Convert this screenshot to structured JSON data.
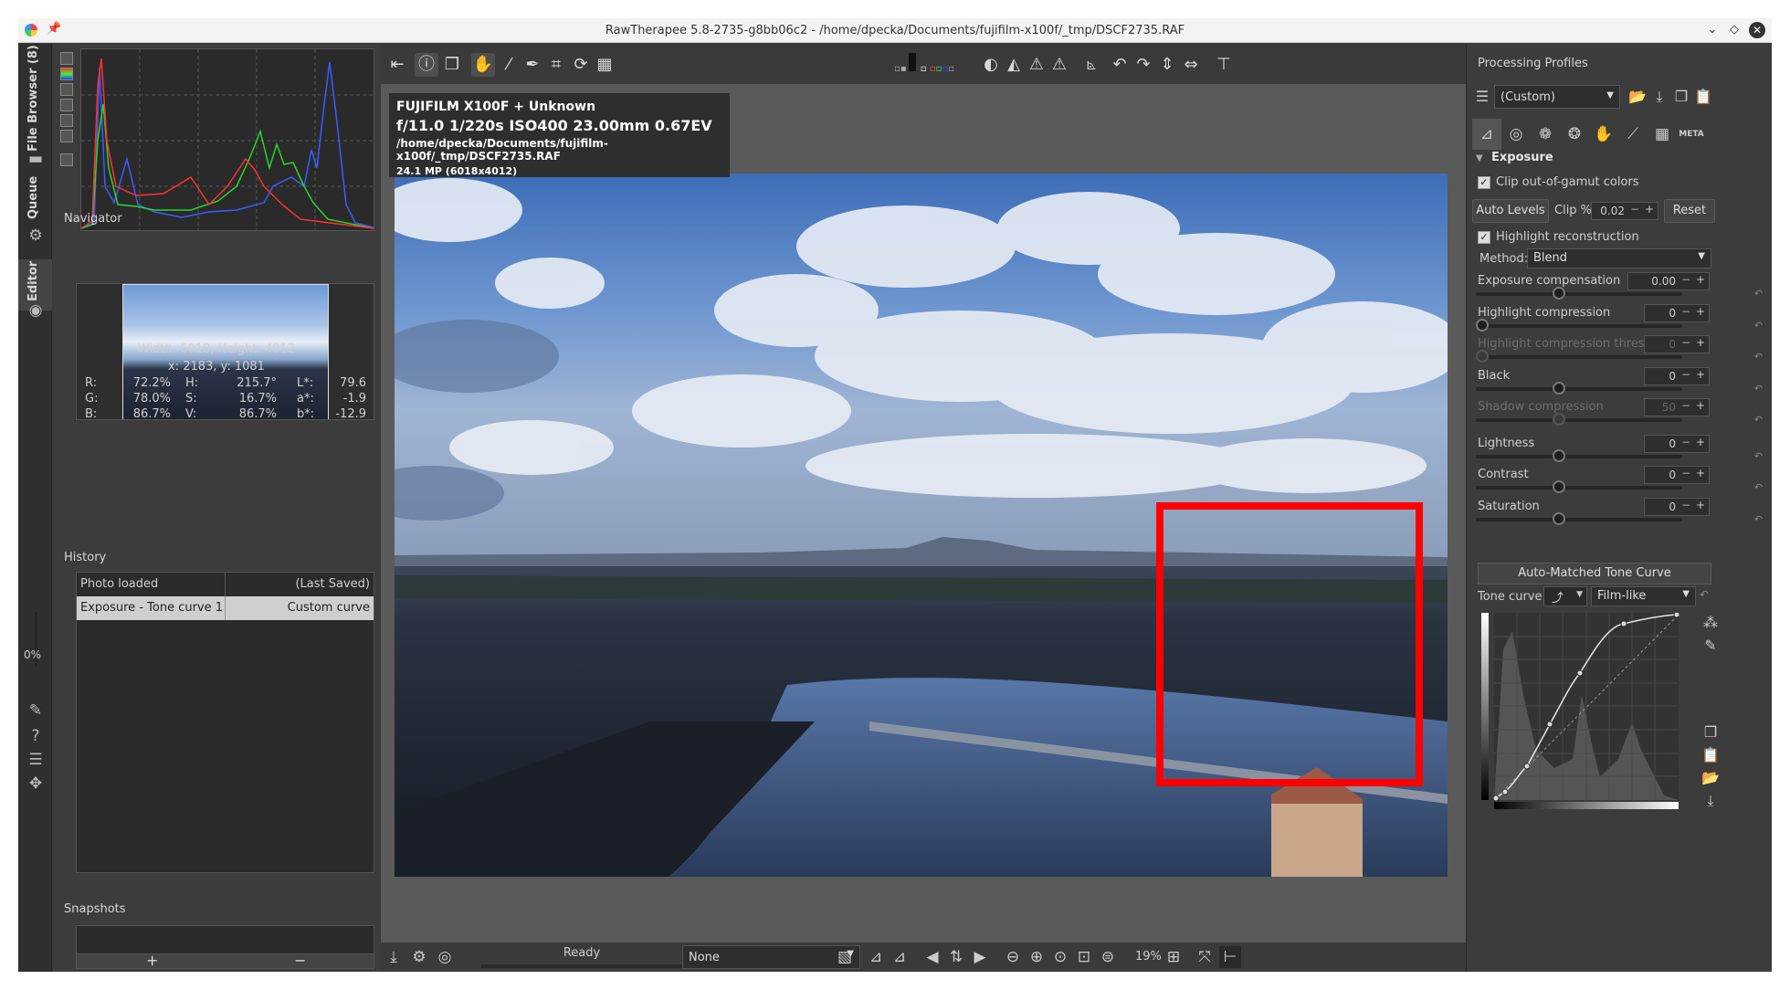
{
  "window": {
    "title": "RawTherapee 5.8-2735-g8bb06c2 - /home/dpecka/Documents/fujifilm-x100f/_tmp/DSCF2735.RAF"
  },
  "vtabs": {
    "file_browser": "File Browser (8)",
    "queue": "Queue",
    "editor": "Editor",
    "progress": "0%"
  },
  "left": {
    "navigator_title": "Navigator",
    "dimensions": "Width: 6018, Height: 4012",
    "cursor": "x: 2183, y: 1081",
    "pixel_rows": [
      {
        "a": "R:",
        "av": "72.2%",
        "b": "H:",
        "bv": "215.7°",
        "c": "L*:",
        "cv": "79.6"
      },
      {
        "a": "G:",
        "av": "78.0%",
        "b": "S:",
        "bv": "16.7%",
        "c": "a*:",
        "cv": "-1.9"
      },
      {
        "a": "B:",
        "av": "86.7%",
        "b": "V:",
        "bv": "86.7%",
        "c": "b*:",
        "cv": "-12.9"
      }
    ],
    "history_title": "History",
    "history": [
      {
        "action": "Photo loaded",
        "value": "(Last Saved)"
      },
      {
        "action": "Exposure - Tone curve 1",
        "value": "Custom curve"
      }
    ],
    "snapshots_title": "Snapshots",
    "snap_add": "+",
    "snap_remove": "−"
  },
  "overlay": {
    "camera": "FUJIFILM X100F + Unknown",
    "exposure": "f/11.0  1/220s  ISO400  23.00mm  0.67EV",
    "path": "/home/dpecka/Documents/fujifilm-x100f/_tmp/DSCF2735.RAF",
    "size": "24.1 MP (6018x4012)"
  },
  "bottom": {
    "status": "Ready",
    "preset": "None",
    "zoom": "19%"
  },
  "right": {
    "title": "Processing Profiles",
    "profile": "(Custom)",
    "meta_tab": "META",
    "section": "Exposure",
    "clip_gamut": "Clip out-of-gamut colors",
    "auto_levels": "Auto Levels",
    "clip_label": "Clip %",
    "clip_value": "0.02",
    "reset": "Reset",
    "highlight_recon": "Highlight reconstruction",
    "method_label": "Method:",
    "method_value": "Blend",
    "sliders": [
      {
        "label": "Exposure compensation",
        "value": "0.00",
        "pos": 0.39,
        "enabled": true
      },
      {
        "label": "Highlight compression",
        "value": "0",
        "pos": 0.0,
        "enabled": true
      },
      {
        "label": "Highlight compression threshold",
        "value": "0",
        "pos": 0.0,
        "enabled": false
      },
      {
        "label": "Black",
        "value": "0",
        "pos": 0.39,
        "enabled": true
      },
      {
        "label": "Shadow compression",
        "value": "50",
        "pos": 0.39,
        "enabled": false
      },
      {
        "label": "Lightness",
        "value": "0",
        "pos": 0.39,
        "enabled": true
      },
      {
        "label": "Contrast",
        "value": "0",
        "pos": 0.39,
        "enabled": true
      },
      {
        "label": "Saturation",
        "value": "0",
        "pos": 0.39,
        "enabled": true
      }
    ],
    "amtc": "Auto-Matched Tone Curve",
    "tone_curve_label": "Tone curve 1:",
    "tone_curve_mode": "Film-like"
  },
  "colors": {
    "highlight": "#ff0000",
    "panel_bg": "#3c3c3c",
    "canvas_bg": "#5a5a5a"
  }
}
